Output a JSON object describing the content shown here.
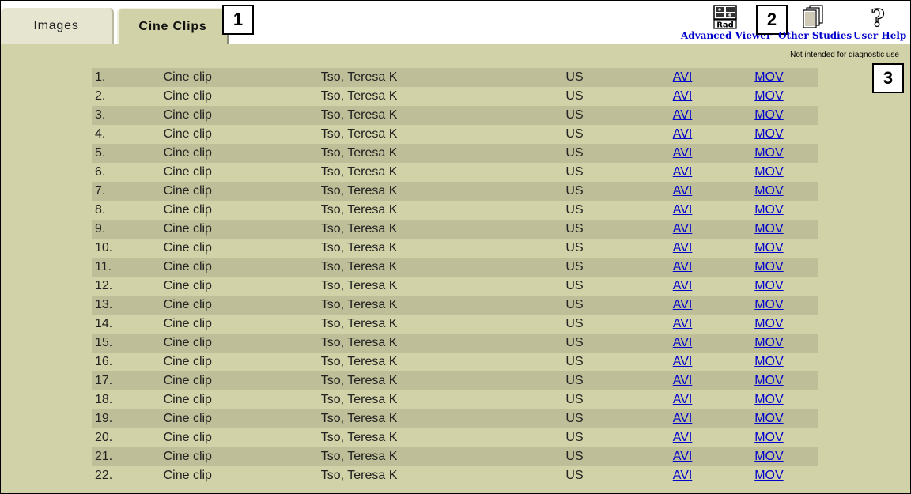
{
  "tabs": [
    {
      "label": "Images",
      "active": false
    },
    {
      "label": "Cine Clips",
      "active": true
    }
  ],
  "callouts": [
    "1",
    "2",
    "3"
  ],
  "toolbar": {
    "advanced_viewer": {
      "label": "Advanced Viewer",
      "icon": "rad-viewer-icon",
      "icon_text": "Rad"
    },
    "other_studies": {
      "label": "Other Studies",
      "icon": "stacked-pages-icon"
    },
    "user_help": {
      "label": "User Help",
      "icon": "question-mark-icon"
    }
  },
  "disclaimer": "Not intended for diagnostic use",
  "colors": {
    "panel_bg": "#d2d2a8",
    "row_stripe": "#bebe98",
    "link": "#0000cc"
  },
  "clips": [
    {
      "num": "1.",
      "type": "Cine clip",
      "patient": "Tso, Teresa K",
      "modality": "US",
      "avi": "AVI",
      "mov": "MOV"
    },
    {
      "num": "2.",
      "type": "Cine clip",
      "patient": "Tso, Teresa K",
      "modality": "US",
      "avi": "AVI",
      "mov": "MOV"
    },
    {
      "num": "3.",
      "type": "Cine clip",
      "patient": "Tso, Teresa K",
      "modality": "US",
      "avi": "AVI",
      "mov": "MOV"
    },
    {
      "num": "4.",
      "type": "Cine clip",
      "patient": "Tso, Teresa K",
      "modality": "US",
      "avi": "AVI",
      "mov": "MOV"
    },
    {
      "num": "5.",
      "type": "Cine clip",
      "patient": "Tso, Teresa K",
      "modality": "US",
      "avi": "AVI",
      "mov": "MOV"
    },
    {
      "num": "6.",
      "type": "Cine clip",
      "patient": "Tso, Teresa K",
      "modality": "US",
      "avi": "AVI",
      "mov": "MOV"
    },
    {
      "num": "7.",
      "type": "Cine clip",
      "patient": "Tso, Teresa K",
      "modality": "US",
      "avi": "AVI",
      "mov": "MOV"
    },
    {
      "num": "8.",
      "type": "Cine clip",
      "patient": "Tso, Teresa K",
      "modality": "US",
      "avi": "AVI",
      "mov": "MOV"
    },
    {
      "num": "9.",
      "type": "Cine clip",
      "patient": "Tso, Teresa K",
      "modality": "US",
      "avi": "AVI",
      "mov": "MOV"
    },
    {
      "num": "10.",
      "type": "Cine clip",
      "patient": "Tso, Teresa K",
      "modality": "US",
      "avi": "AVI",
      "mov": "MOV"
    },
    {
      "num": "11.",
      "type": "Cine clip",
      "patient": "Tso, Teresa K",
      "modality": "US",
      "avi": "AVI",
      "mov": "MOV"
    },
    {
      "num": "12.",
      "type": "Cine clip",
      "patient": "Tso, Teresa K",
      "modality": "US",
      "avi": "AVI",
      "mov": "MOV"
    },
    {
      "num": "13.",
      "type": "Cine clip",
      "patient": "Tso, Teresa K",
      "modality": "US",
      "avi": "AVI",
      "mov": "MOV"
    },
    {
      "num": "14.",
      "type": "Cine clip",
      "patient": "Tso, Teresa K",
      "modality": "US",
      "avi": "AVI",
      "mov": "MOV"
    },
    {
      "num": "15.",
      "type": "Cine clip",
      "patient": "Tso, Teresa K",
      "modality": "US",
      "avi": "AVI",
      "mov": "MOV"
    },
    {
      "num": "16.",
      "type": "Cine clip",
      "patient": "Tso, Teresa K",
      "modality": "US",
      "avi": "AVI",
      "mov": "MOV"
    },
    {
      "num": "17.",
      "type": "Cine clip",
      "patient": "Tso, Teresa K",
      "modality": "US",
      "avi": "AVI",
      "mov": "MOV"
    },
    {
      "num": "18.",
      "type": "Cine clip",
      "patient": "Tso, Teresa K",
      "modality": "US",
      "avi": "AVI",
      "mov": "MOV"
    },
    {
      "num": "19.",
      "type": "Cine clip",
      "patient": "Tso, Teresa K",
      "modality": "US",
      "avi": "AVI",
      "mov": "MOV"
    },
    {
      "num": "20.",
      "type": "Cine clip",
      "patient": "Tso, Teresa K",
      "modality": "US",
      "avi": "AVI",
      "mov": "MOV"
    },
    {
      "num": "21.",
      "type": "Cine clip",
      "patient": "Tso, Teresa K",
      "modality": "US",
      "avi": "AVI",
      "mov": "MOV"
    },
    {
      "num": "22.",
      "type": "Cine clip",
      "patient": "Tso, Teresa K",
      "modality": "US",
      "avi": "AVI",
      "mov": "MOV"
    }
  ]
}
